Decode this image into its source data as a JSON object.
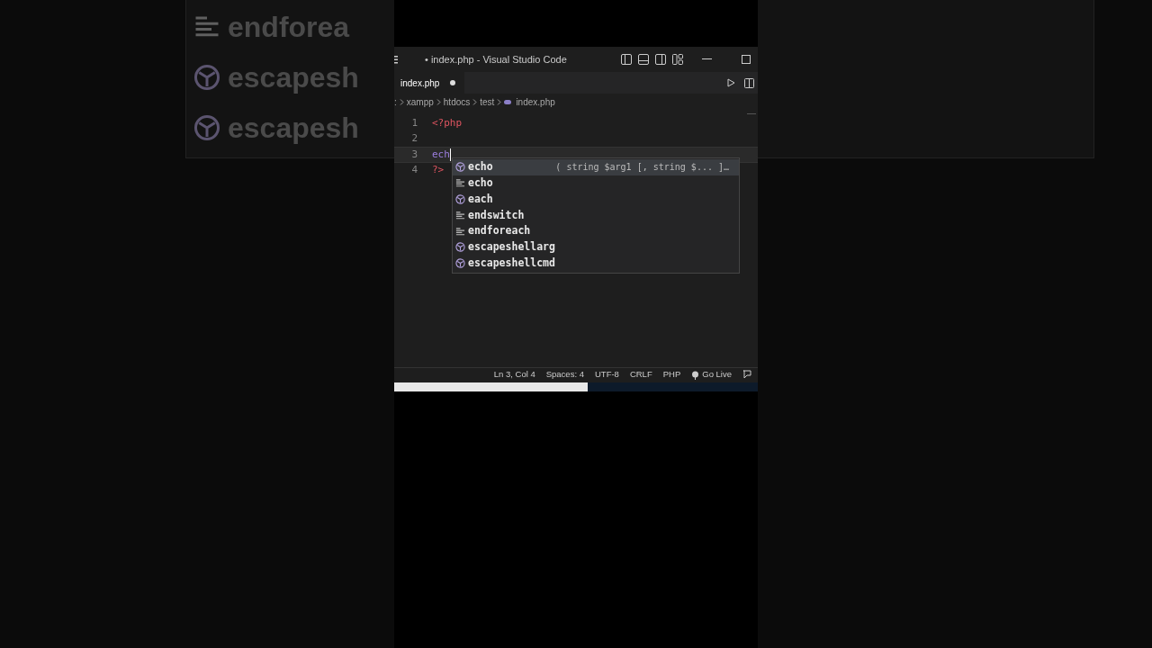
{
  "background_ghost": [
    {
      "kind": "snippet",
      "label": "endforea"
    },
    {
      "kind": "keyword",
      "label": "escapesh"
    },
    {
      "kind": "keyword",
      "label": "escapesh"
    }
  ],
  "window": {
    "title": "• index.php - Visual Studio Code"
  },
  "tabs": [
    {
      "label": "index.php",
      "selected": true,
      "modified": true
    }
  ],
  "breadcrumb": [
    ":",
    "xampp",
    "htdocs",
    "test",
    "index.php"
  ],
  "lines": [
    {
      "number": "1",
      "tokens": [
        {
          "text": "<?php",
          "kind": "tag"
        }
      ],
      "current": false
    },
    {
      "number": "2",
      "current": false
    },
    {
      "number": "3",
      "tokens": [
        {
          "text": "ech",
          "kind": "typed"
        }
      ],
      "current": true
    },
    {
      "number": "4",
      "tokens": [
        {
          "text": "?>",
          "kind": "tag"
        }
      ],
      "current": false
    }
  ],
  "suggestions": [
    {
      "label": "echo",
      "kind": "keyword",
      "selected": true,
      "detail": "( string $arg1 [, string $... ]…"
    },
    {
      "label": "echo",
      "kind": "snippet",
      "selected": false
    },
    {
      "label": "each",
      "kind": "keyword",
      "selected": false
    },
    {
      "label": "endswitch",
      "kind": "snippet",
      "selected": false
    },
    {
      "label": "endforeach",
      "kind": "snippet",
      "selected": false
    },
    {
      "label": "escapeshellarg",
      "kind": "keyword",
      "selected": false
    },
    {
      "label": "escapeshellcmd",
      "kind": "keyword",
      "selected": false
    }
  ],
  "status_bar": [
    {
      "kind": "text",
      "label": "Ln 3, Col 4"
    },
    {
      "kind": "text",
      "label": "Spaces: 4"
    },
    {
      "kind": "text",
      "label": "UTF-8"
    },
    {
      "kind": "text",
      "label": "CRLF"
    },
    {
      "kind": "text",
      "label": "PHP"
    },
    {
      "kind": "live",
      "label": "Go Live"
    }
  ]
}
